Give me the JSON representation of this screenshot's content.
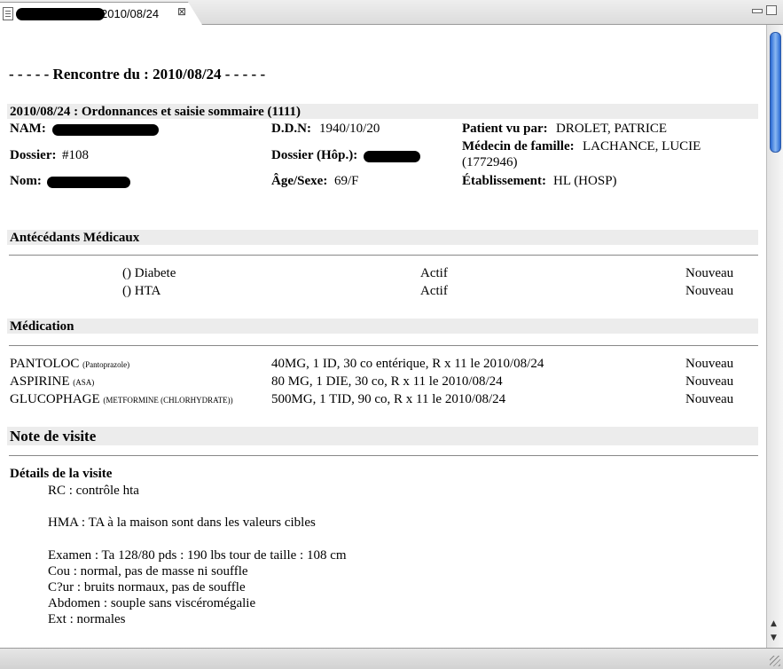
{
  "tab": {
    "title": "2010/08/24",
    "close": "⊠"
  },
  "report": {
    "heading": "- - - - - Rencontre du : 2010/08/24 - - - - -",
    "encounter_title": "2010/08/24 : Ordonnances et saisie sommaire (1111)",
    "nam_label": "NAM:",
    "dossier_label": "Dossier:",
    "dossier_value": "#108",
    "nom_label": "Nom:",
    "ddn_label": "D.D.N:",
    "ddn_value": "1940/10/20",
    "dossier_hop_label": "Dossier (Hôp.):",
    "age_label": "Âge/Sexe:",
    "age_value": "69/F",
    "patient_vu_label": "Patient vu par:",
    "patient_vu_value": "DROLET, PATRICE",
    "medecin_label": "Médecin de famille:",
    "medecin_value": "LACHANCE, LUCIE",
    "medecin_value2": "(1772946)",
    "etab_label": "Établissement:",
    "etab_value": "HL (HOSP)"
  },
  "antecedents": {
    "title": "Antécédants Médicaux",
    "rows": [
      {
        "name": "() Diabete",
        "status": "Actif",
        "tag": "Nouveau"
      },
      {
        "name": "() HTA",
        "status": "Actif",
        "tag": "Nouveau"
      }
    ]
  },
  "medication": {
    "title": "Médication",
    "rows": [
      {
        "name": "PANTOLOC",
        "generic": "(Pantoprazole)",
        "dose": "40MG, 1 ID, 30 co entérique, R x 11 le 2010/08/24",
        "tag": "Nouveau"
      },
      {
        "name": "ASPIRINE",
        "generic": "(ASA)",
        "dose": "80 MG, 1 DIE, 30 co, R x 11 le 2010/08/24",
        "tag": "Nouveau"
      },
      {
        "name": "GLUCOPHAGE",
        "generic": "(METFORMINE (CHLORHYDRATE))",
        "dose": "500MG, 1 TID, 90 co, R x 11 le 2010/08/24",
        "tag": "Nouveau"
      }
    ]
  },
  "note": {
    "title": "Note de visite",
    "details_title": "Détails de la visite",
    "lines": [
      "RC : contrôle hta",
      "HMA : TA à la maison sont dans les valeurs cibles",
      "Examen : Ta 128/80 pds : 190 lbs tour de taille : 108 cm",
      "Cou : normal, pas de masse ni souffle",
      "C?ur : bruits normaux, pas de souffle",
      "Abdomen : souple sans viscéromégalie",
      "Ext : normales"
    ]
  },
  "scroll": {
    "up": "▲",
    "down": "▼"
  }
}
